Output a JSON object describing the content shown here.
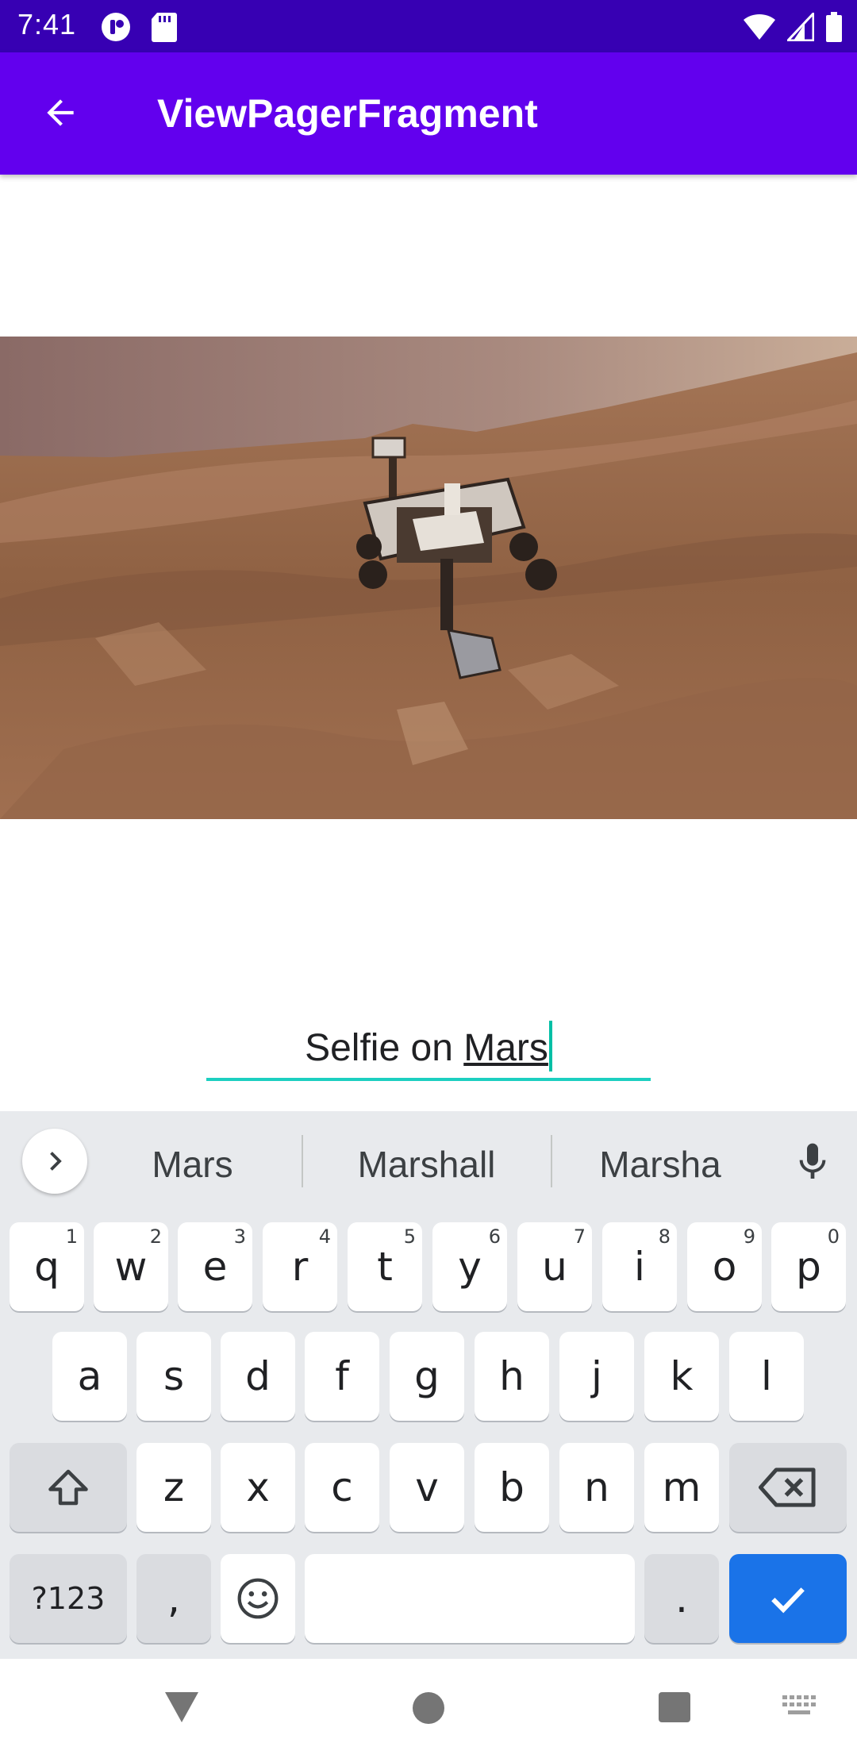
{
  "status": {
    "time": "7:41"
  },
  "appbar": {
    "title": "ViewPagerFragment",
    "back_icon": "arrow-back-icon"
  },
  "photo": {
    "description_icon": "mars-rover-photo"
  },
  "caption": {
    "text_plain": "Selfie on ",
    "text_composing": "Mars"
  },
  "keyboard": {
    "suggestions": [
      "Mars",
      "Marshall",
      "Marsha"
    ],
    "row1": [
      {
        "key": "q",
        "hint": "1"
      },
      {
        "key": "w",
        "hint": "2"
      },
      {
        "key": "e",
        "hint": "3"
      },
      {
        "key": "r",
        "hint": "4"
      },
      {
        "key": "t",
        "hint": "5"
      },
      {
        "key": "y",
        "hint": "6"
      },
      {
        "key": "u",
        "hint": "7"
      },
      {
        "key": "i",
        "hint": "8"
      },
      {
        "key": "o",
        "hint": "9"
      },
      {
        "key": "p",
        "hint": "0"
      }
    ],
    "row2": [
      "a",
      "s",
      "d",
      "f",
      "g",
      "h",
      "j",
      "k",
      "l"
    ],
    "row3": [
      "z",
      "x",
      "c",
      "v",
      "b",
      "n",
      "m"
    ],
    "symbols_label": "?123",
    "comma_label": ",",
    "period_label": "."
  },
  "colors": {
    "statusbar": "#3700b3",
    "appbar": "#6200ee",
    "accent": "#1ccfc0",
    "action": "#1a73e8"
  }
}
